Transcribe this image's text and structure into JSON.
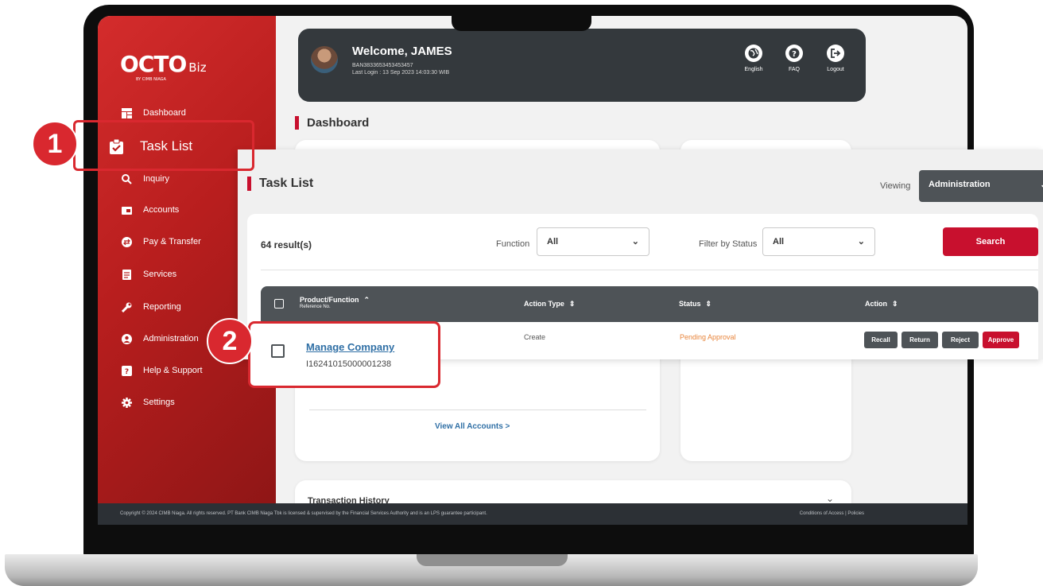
{
  "app": {
    "logo": "OCTO",
    "logo_suffix": "Biz",
    "logo_sub": "BY CIMB NIAGA"
  },
  "sidebar": {
    "items": [
      {
        "label": "Dashboard",
        "icon": "dashboard-icon"
      },
      {
        "label": "Task List",
        "icon": "clipboard-check-icon",
        "active": true
      },
      {
        "label": "Inquiry",
        "icon": "search-icon"
      },
      {
        "label": "Accounts",
        "icon": "wallet-icon"
      },
      {
        "label": "Pay & Transfer",
        "icon": "transfer-icon"
      },
      {
        "label": "Services",
        "icon": "document-icon"
      },
      {
        "label": "Reporting",
        "icon": "wrench-icon"
      },
      {
        "label": "Administration",
        "icon": "user-circle-icon"
      },
      {
        "label": "Help & Support",
        "icon": "question-icon"
      },
      {
        "label": "Settings",
        "icon": "gear-icon"
      }
    ]
  },
  "header": {
    "welcome": "Welcome, JAMES",
    "user_id": "BAN3833653453453457",
    "last_login": "Last Login : 13 Sep 2023 14:03:30 WIB",
    "actions": [
      {
        "label": "English",
        "icon": "globe-icon"
      },
      {
        "label": "FAQ",
        "icon": "question-circle-icon"
      },
      {
        "label": "Logout",
        "icon": "logout-icon"
      }
    ]
  },
  "dashboard": {
    "title": "Dashboard",
    "view_all": "View All Accounts >",
    "transaction_history": "Transaction History"
  },
  "footer": {
    "copyright": "Copyright © 2024 CIMB Niaga. All rights reserved. PT Bank CIMB Niaga Tbk is licensed & supervised by the Financial Services Authority and is an LPS guarantee participant.",
    "links": "Conditions of Access  |  Policies"
  },
  "task_list": {
    "title": "Task List",
    "viewing_label": "Viewing",
    "viewing_value": "Administration",
    "results": "64 result(s)",
    "function_label": "Function",
    "function_value": "All",
    "status_label": "Filter by Status",
    "status_value": "All",
    "search_label": "Search",
    "columns": {
      "product": "Product/Function",
      "product_sub": "Reference No.",
      "action_type": "Action Type",
      "status": "Status",
      "action": "Action"
    },
    "rows": [
      {
        "product": "Manage Company",
        "reference": "I16241015000001238",
        "action_type": "Create",
        "status": "Pending Approval",
        "buttons": [
          "Recall",
          "Return",
          "Reject",
          "Approve"
        ]
      }
    ]
  },
  "callouts": [
    "1",
    "2"
  ]
}
